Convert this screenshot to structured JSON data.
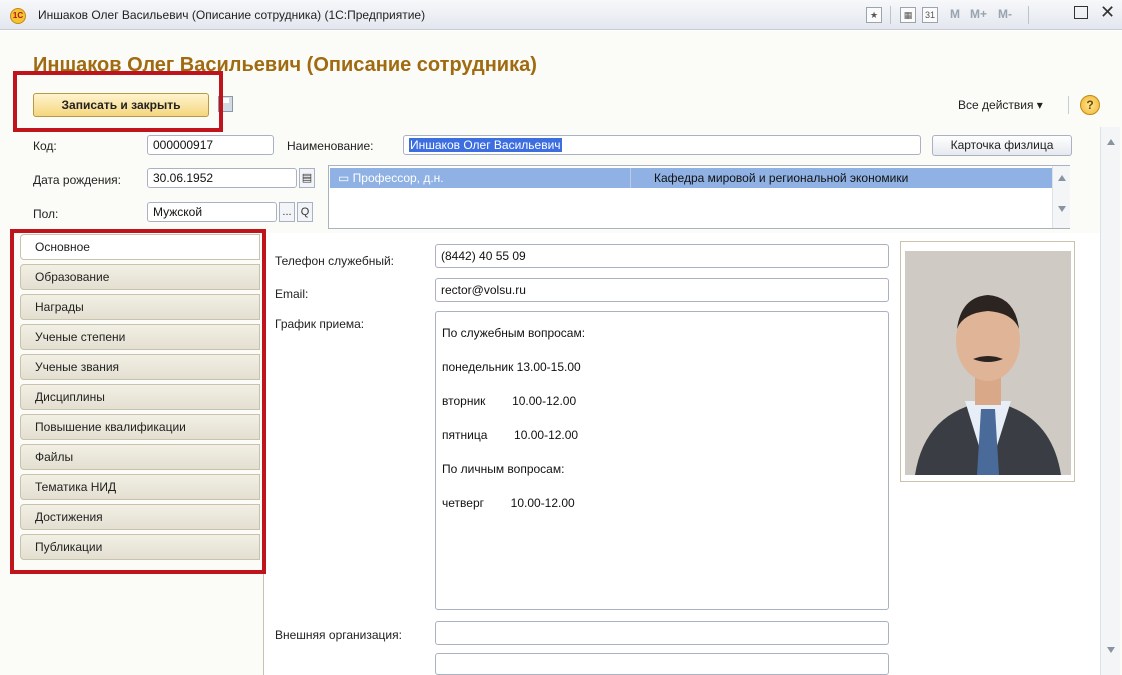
{
  "window": {
    "app_icon_text": "1С",
    "title": "Иншаков Олег Васильевич (Описание сотрудника) (1С:Предприятие)",
    "toolbar_m": "M",
    "toolbar_m_plus": "M+",
    "toolbar_m_minus": "M-",
    "close_glyph": "✕"
  },
  "form": {
    "title": "Иншаков Олег Васильевич (Описание сотрудника)",
    "save_close_label": "Записать и закрыть",
    "all_actions_label": "Все действия ▾",
    "help_label": "?"
  },
  "fields": {
    "code_label": "Код:",
    "code_value": "000000917",
    "name_label": "Наименование:",
    "name_value": "Иншаков Олег Васильевич",
    "card_button": "Карточка физлица",
    "birth_label": "Дата рождения:",
    "birth_value": "30.06.1952",
    "gender_label": "Пол:",
    "gender_value": "Мужской",
    "gender_select_btn": "...",
    "gender_search_btn": "Q"
  },
  "positions": [
    {
      "title": "Профессор, д.н.",
      "department": "Кафедра мировой и региональной экономики"
    }
  ],
  "tabs": [
    "Основное",
    "Образование",
    "Награды",
    "Ученые степени",
    "Ученые звания",
    "Дисциплины",
    "Повышение квалификации",
    "Файлы",
    "Тематика НИД",
    "Достижения",
    "Публикации"
  ],
  "main": {
    "phone_label": "Телефон служебный:",
    "phone_value": "(8442) 40 55 09",
    "email_label": "Email:",
    "email_value": "rector@volsu.ru",
    "schedule_label": "График приема:",
    "schedule_lines": [
      "По служебным вопросам:",
      "понедельник 13.00-15.00",
      "вторник        10.00-12.00",
      "пятница        10.00-12.00",
      "По личным вопросам:",
      "четверг        10.00-12.00"
    ],
    "external_org_label": "Внешняя организация:",
    "external_org_value": ""
  },
  "colors": {
    "title_color": "#a06a10",
    "highlight_border": "#c0141c",
    "selection_bg": "#3d6ee0",
    "row_bg": "#8fb1e3"
  }
}
